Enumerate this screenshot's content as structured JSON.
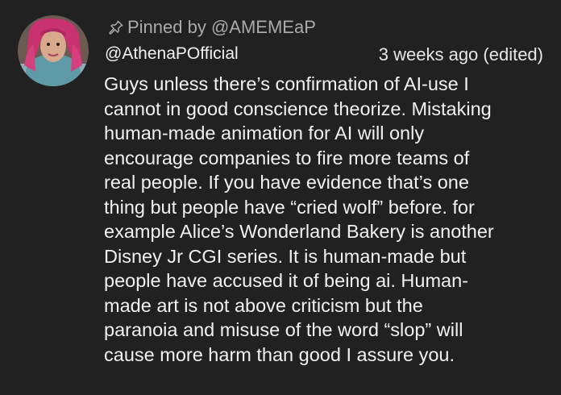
{
  "comment": {
    "pinned_by": "Pinned by @AMEMEaP",
    "author": "@AthenaPOfficial",
    "timestamp": "3 weeks ago (edited)",
    "avatar_icon": "profile-avatar",
    "pin_icon": "pin-icon",
    "body_lines": [
      "Guys unless there’s confirmation of AI-use I",
      "cannot in good conscience theorize. Mistaking",
      "human-made animation for AI will only",
      "encourage companies to fire more teams of",
      "real people. If you have evidence that’s one",
      "thing but people have “cried wolf” before. for",
      "example Alice’s Wonderland Bakery is another",
      "Disney Jr CGI series. It is human-made but",
      "people have accused it of being ai. Human-",
      "made art is not above criticism but the",
      "paranoia and misuse of the word “slop” will",
      "cause more harm than good I assure you."
    ]
  },
  "colors": {
    "background": "#212121",
    "primary_text": "#f1f1f1",
    "secondary_text": "#aaaaaa"
  }
}
